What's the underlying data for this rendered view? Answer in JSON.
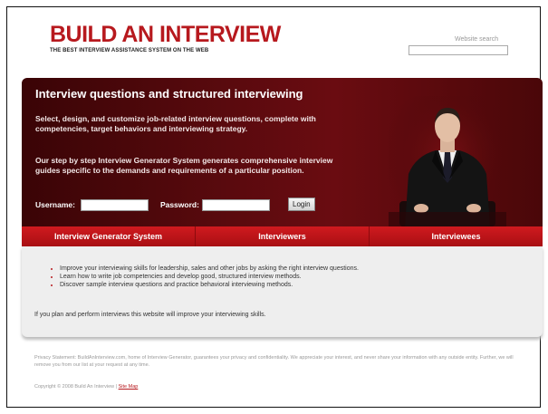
{
  "header": {
    "logo_title": "BUILD AN INTERVIEW",
    "logo_subtitle": "THE BEST INTERVIEW ASSISTANCE SYSTEM ON THE WEB",
    "search_label": "Website search",
    "search_value": ""
  },
  "hero": {
    "heading": "Interview questions and structured interviewing",
    "paragraph1": "Select, design, and customize job-related interview questions, complete with competencies, target behaviors and interviewing strategy.",
    "paragraph2": "Our step by step Interview Generator System generates comprehensive interview guides specific to the demands and requirements of a particular position.",
    "username_label": "Username:",
    "username_value": "",
    "password_label": "Password:",
    "password_value": "",
    "login_button": "Login"
  },
  "nav": {
    "items": [
      "Interview Generator System",
      "Interviewers",
      "Interviewees"
    ]
  },
  "content": {
    "bullets": [
      "Improve your interviewing skills for leadership, sales and other jobs by asking the right interview questions.",
      "Learn how to write job competencies and develop good, structured interview methods.",
      "Discover sample interview questions and practice behavioral interviewing methods."
    ],
    "closing": "If you plan and perform interviews this website will improve your interviewing skills."
  },
  "footer": {
    "privacy": "Privacy Statement: BuildAnInterview.com, home of Interview Generator, guarantees your privacy and confidentiality. We appreciate your interest, and never share your information with any outside entity. Further, we will remove you from our list at your request at any time.",
    "copyright": "Copyright © 2008 Build An Interview  |",
    "sitemap_link": "Site Map"
  },
  "colors": {
    "brand_red": "#b7191e",
    "hero_dark": "#4a0709",
    "nav_red": "#c4161b"
  }
}
